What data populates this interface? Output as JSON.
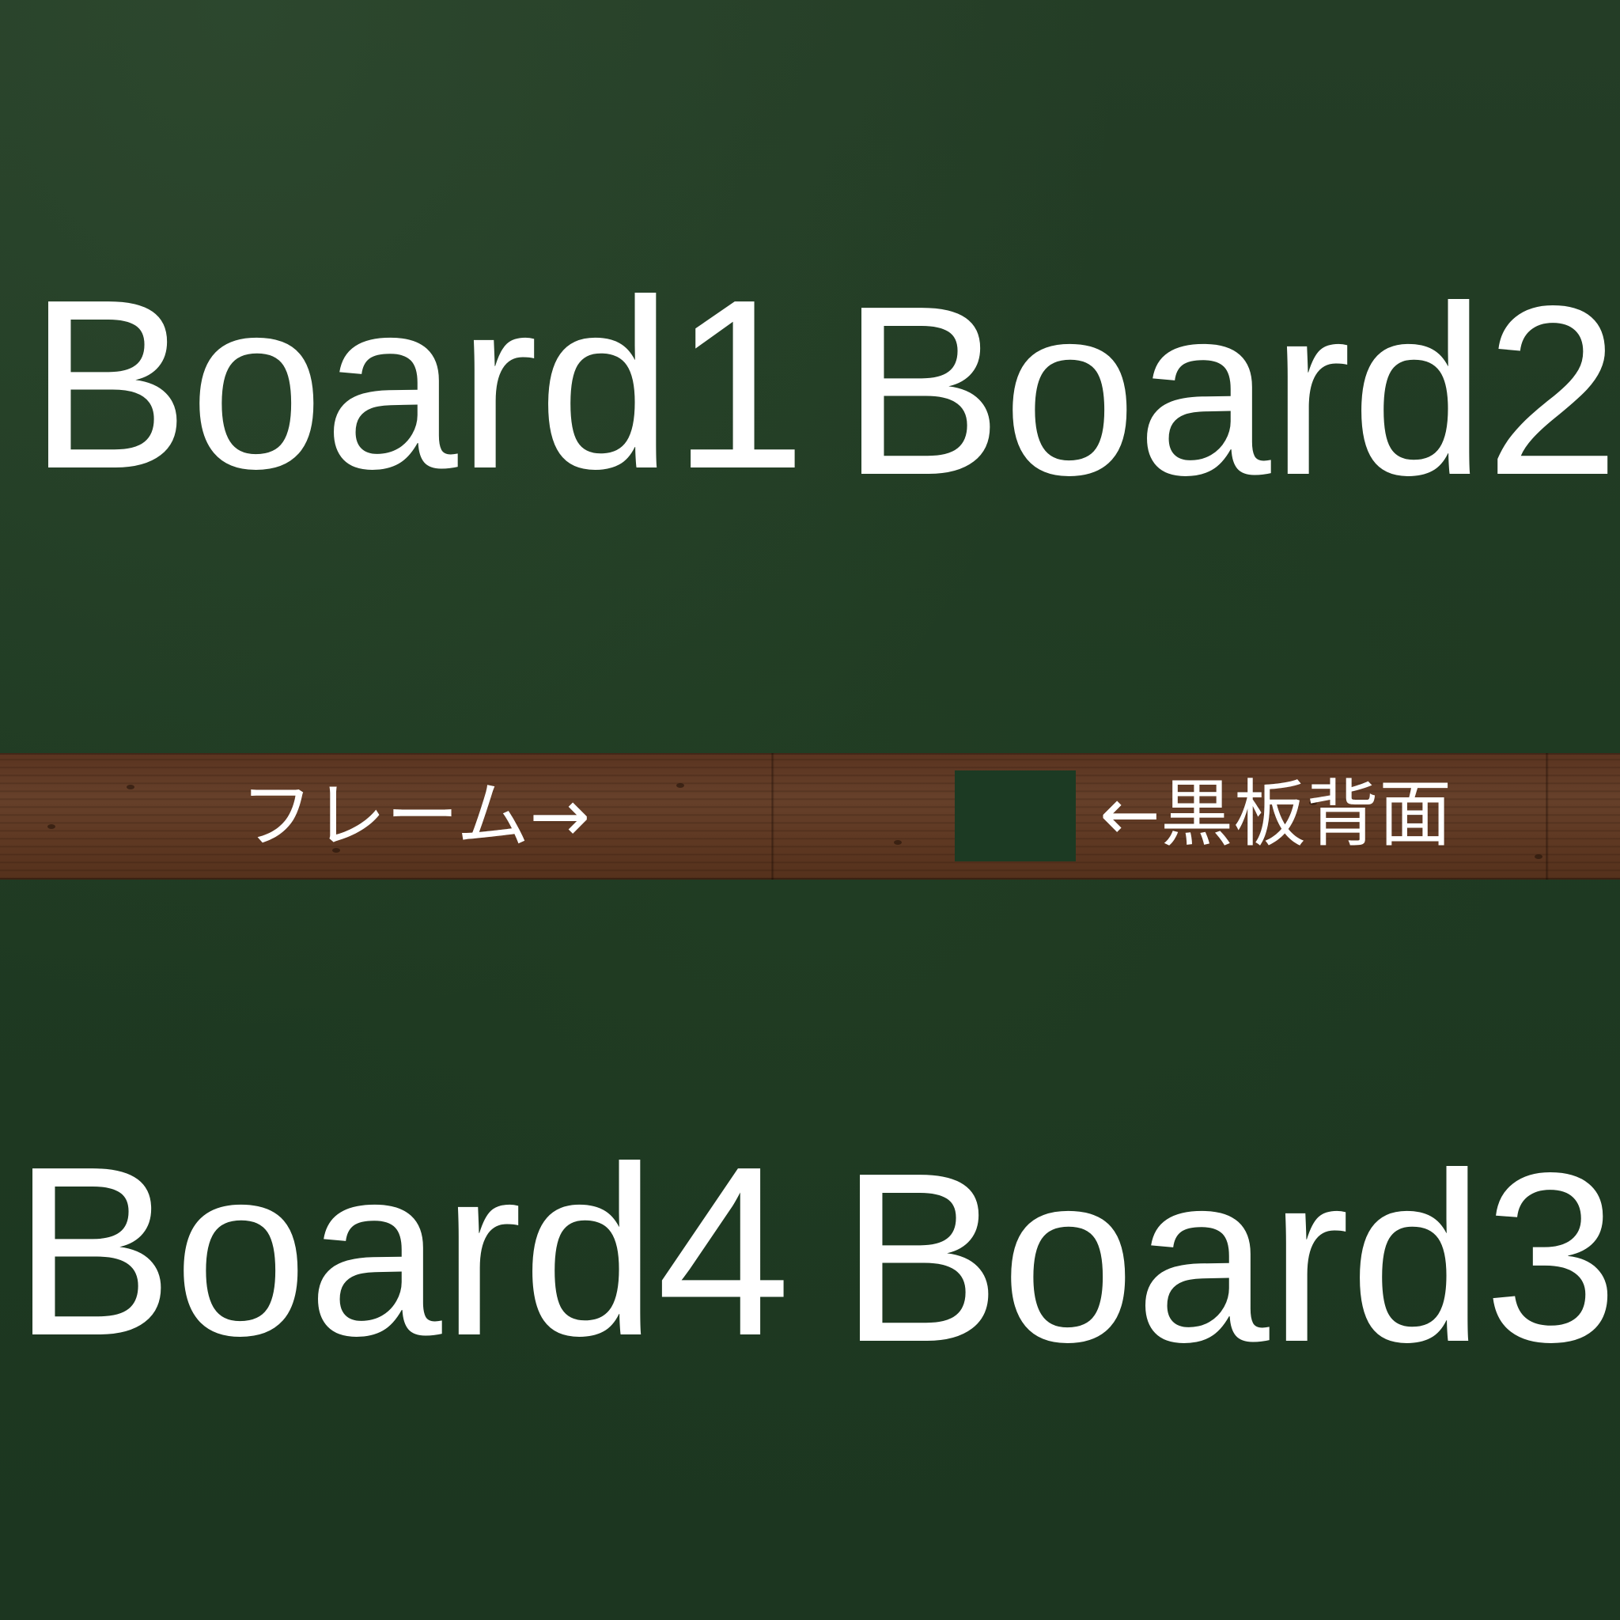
{
  "boards": {
    "board1": "Board1",
    "board2": "Board2",
    "board3": "Board3",
    "board4": "Board4"
  },
  "strip": {
    "frame_label": "フレーム→",
    "backing_label": "←黒板背面"
  },
  "colors": {
    "chalkboard": "#1f3a22",
    "swatch": "#1c3a23",
    "wood": "#5e3822",
    "text": "#ffffff"
  }
}
